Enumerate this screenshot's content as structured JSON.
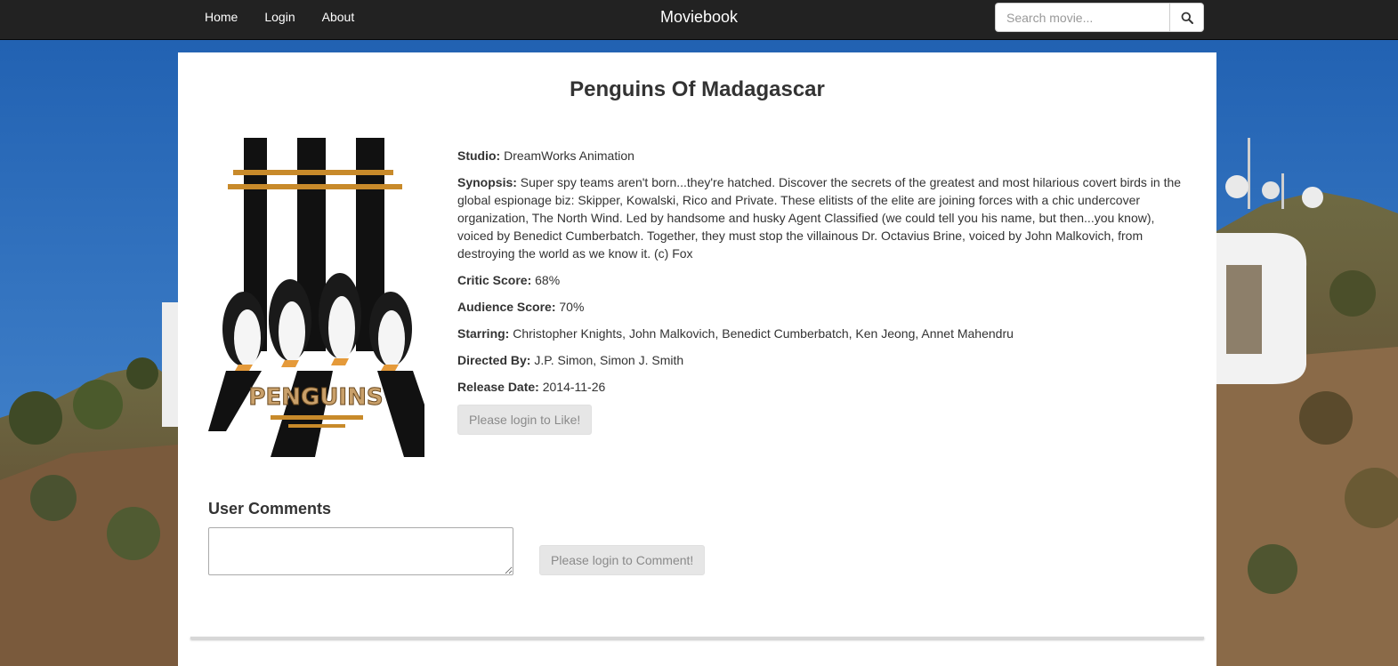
{
  "nav": {
    "links": [
      "Home",
      "Login",
      "About"
    ],
    "brand": "Moviebook",
    "search_placeholder": "Search movie...",
    "search_icon": "search-icon"
  },
  "movie": {
    "title": "Penguins Of Madagascar",
    "poster_text": "PENGUINS",
    "studio_label": "Studio:",
    "studio": "DreamWorks Animation",
    "synopsis_label": "Synopsis:",
    "synopsis": "Super spy teams aren't born...they're hatched. Discover the secrets of the greatest and most hilarious covert birds in the global espionage biz: Skipper, Kowalski, Rico and Private. These elitists of the elite are joining forces with a chic undercover organization, The North Wind. Led by handsome and husky Agent Classified (we could tell you his name, but then...you know), voiced by Benedict Cumberbatch. Together, they must stop the villainous Dr. Octavius Brine, voiced by John Malkovich, from destroying the world as we know it. (c) Fox",
    "critic_label": "Critic Score:",
    "critic_score": "68%",
    "audience_label": "Audience Score:",
    "audience_score": "70%",
    "starring_label": "Starring:",
    "starring": "Christopher Knights, John Malkovich, Benedict Cumberbatch, Ken Jeong, Annet Mahendru",
    "directed_label": "Directed By:",
    "directed_by": "J.P. Simon, Simon J. Smith",
    "release_label": "Release Date:",
    "release_date": "2014-11-26",
    "like_button": "Please login to Like!"
  },
  "comments": {
    "heading": "User Comments",
    "textarea_value": "",
    "comment_button": "Please login to Comment!"
  },
  "colors": {
    "navbar": "#222222",
    "panel": "#ffffff",
    "sky": "#2e6db4",
    "disabled_button": "#e6e6e6"
  }
}
